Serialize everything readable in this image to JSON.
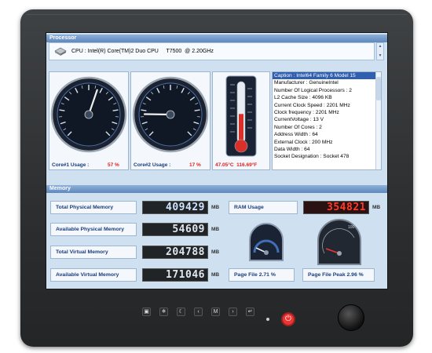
{
  "processor": {
    "section_title": "Processor",
    "cpu_name": "CPU : Intel(R) Core(TM)2 Duo CPU     T7500  @ 2.20GHz",
    "core1": {
      "label": "Core#1 Usage :",
      "value": "57 %",
      "usage": 57
    },
    "core2": {
      "label": "Core#2 Usage :",
      "value": "17 %",
      "usage": 17
    },
    "temperature": {
      "value": "47.05°C  116.69°F",
      "level": 47.05
    },
    "info_items": [
      "Caption : Intel64 Family 6 Model 15",
      "Manufacturer : GenuineIntel",
      "Number Of Logical Processors : 2",
      "L2 Cache Size : 4096 KB",
      "Current Clock Speed : 2201 MHz",
      "Clock frequency : 2201 MHz",
      "CurrentVoltage : 13 V",
      "Number Of Cores : 2",
      "Address Width : 64",
      "External Clock : 200 MHz",
      "Data Width : 64",
      "Socket Designation : Socket 478"
    ]
  },
  "memory": {
    "section_title": "Memory",
    "total_physical": {
      "label": "Total Physical Memory",
      "value": "409429",
      "unit": "MB"
    },
    "available_physical": {
      "label": "Available Physical Memory",
      "value": "54609",
      "unit": "MB"
    },
    "total_virtual": {
      "label": "Total Virtual Memory",
      "value": "204788",
      "unit": "MB"
    },
    "available_virtual": {
      "label": "Available Virtual Memory",
      "value": "171046",
      "unit": "MB"
    },
    "ram_usage": {
      "label": "RAM Usage",
      "value": "354821",
      "unit": "MB"
    },
    "page_file": {
      "label": "Page File  2.71 %",
      "percent": 2.71
    },
    "page_file_peak": {
      "label": "Page File Peak  2.96 %",
      "percent": 2.96,
      "scale_max": "100"
    }
  },
  "bezel_buttons": [
    "▣",
    "✵",
    "☾",
    "‹",
    "M",
    "›",
    "↵"
  ],
  "power_symbol": "⏻",
  "colors": {
    "accent_red": "#d22",
    "header_blue": "#5f88bb",
    "selection_blue": "#2f5fae"
  }
}
